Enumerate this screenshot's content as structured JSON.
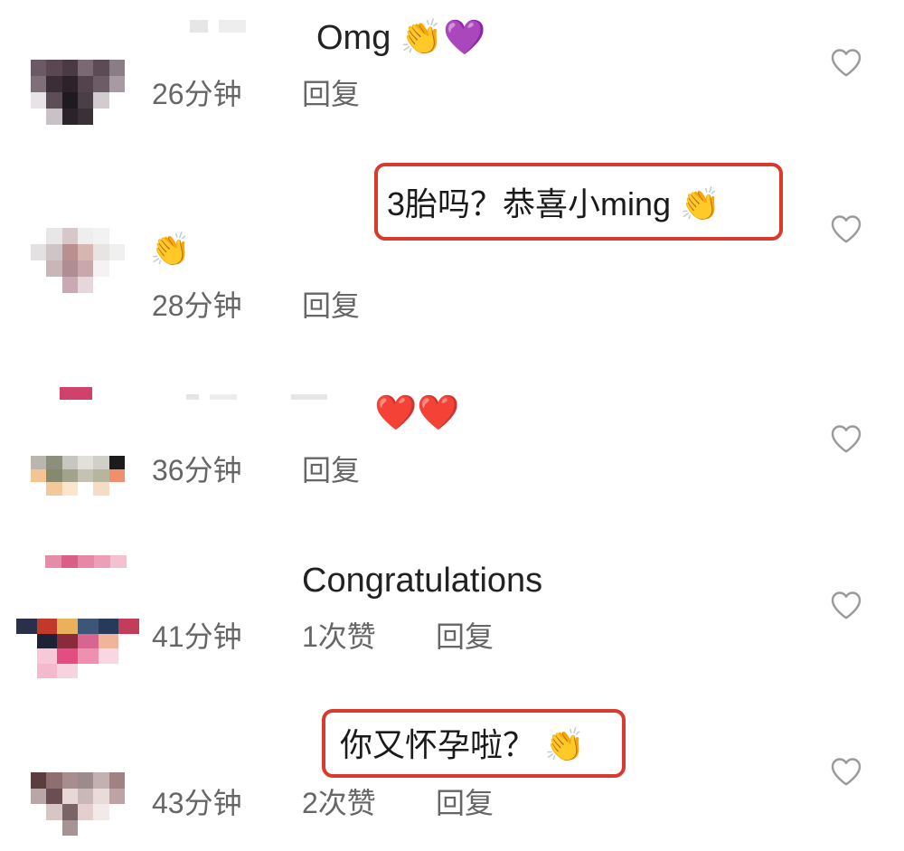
{
  "comments": [
    {
      "text": "Omg 👏💜",
      "time": "26分钟",
      "likes": "",
      "reply": "回复"
    },
    {
      "text": "👏",
      "time": "28分钟",
      "likes": "",
      "reply": "回复",
      "annotation": "3胎吗？恭喜小ming 👏"
    },
    {
      "text": "❤️❤️",
      "time": "36分钟",
      "likes": "",
      "reply": "回复"
    },
    {
      "text": "Congratulations",
      "time": "41分钟",
      "likes": "1次赞",
      "reply": "回复"
    },
    {
      "text": "你又怀孕啦？ 👏",
      "time": "43分钟",
      "likes": "2次赞",
      "reply": "回复"
    }
  ],
  "icons": {
    "like": "heart-outline-icon"
  },
  "colors": {
    "highlight_border": "#d83a2e",
    "meta_text": "#666666",
    "body_text": "#222222",
    "heart_outline": "#9a9a9a"
  }
}
